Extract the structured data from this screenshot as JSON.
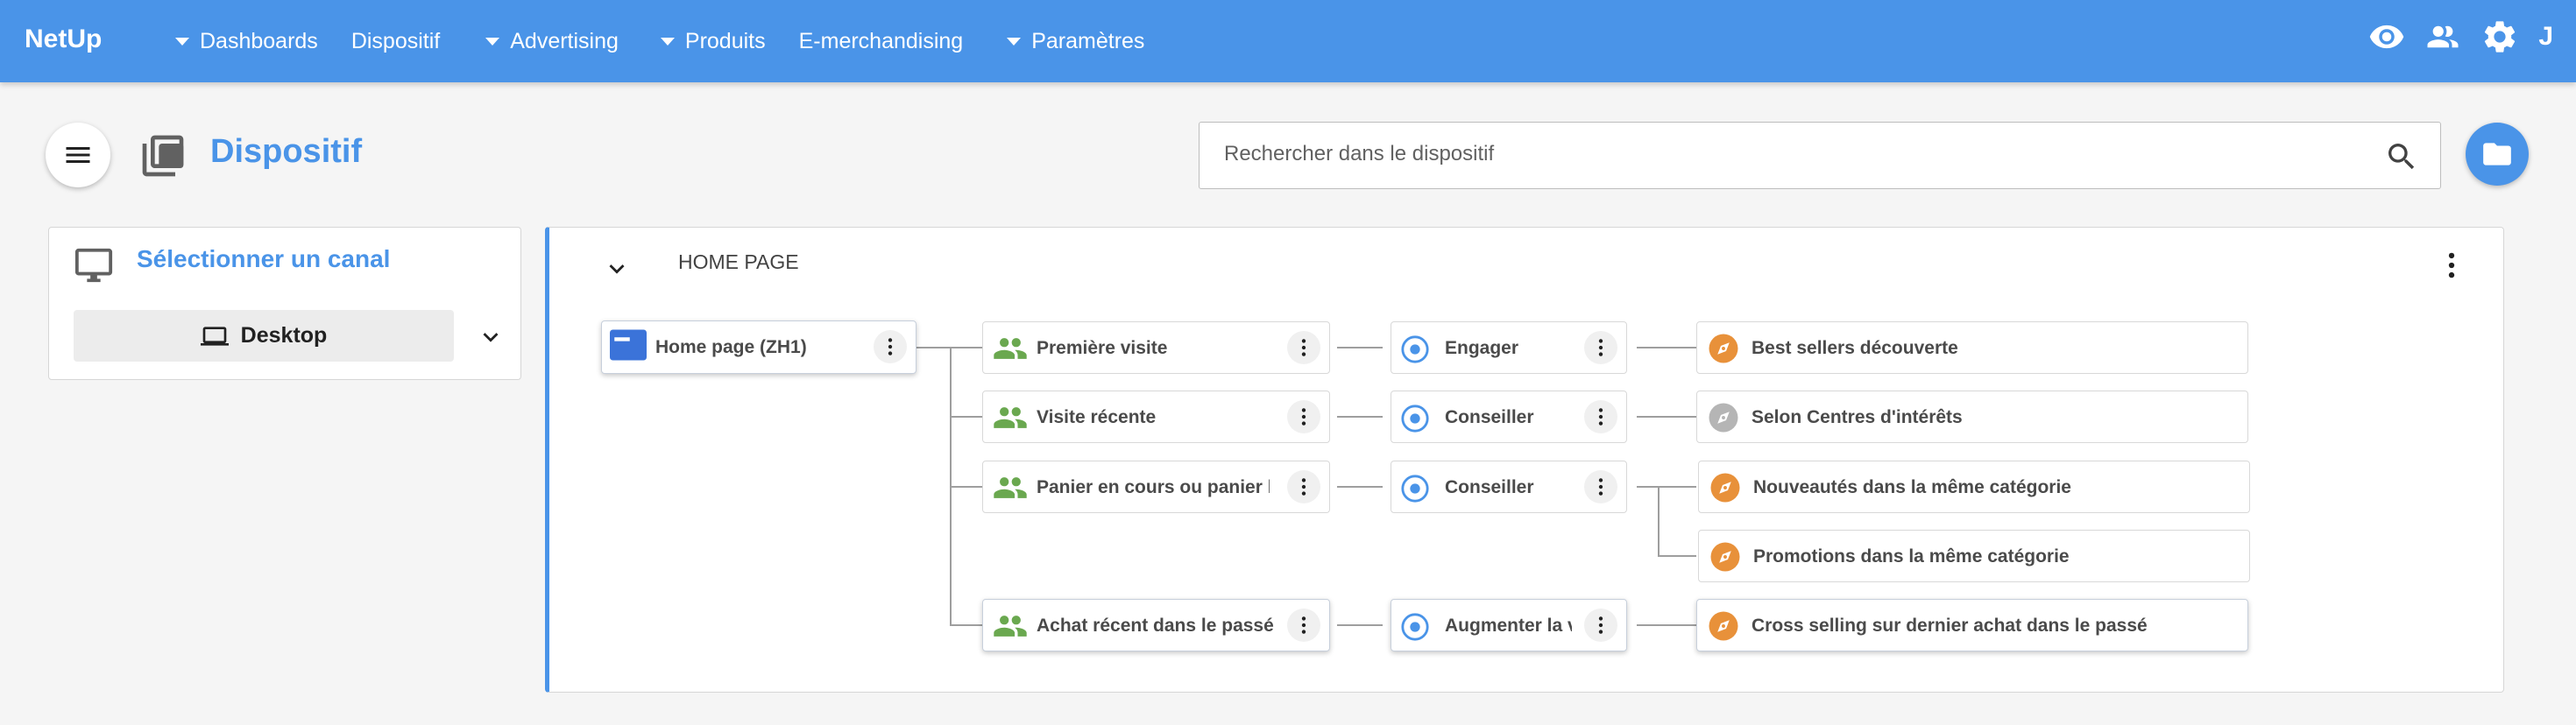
{
  "app": {
    "brand": "NetUp"
  },
  "nav": [
    {
      "label": "Dashboards",
      "dropdown": true
    },
    {
      "label": "Dispositif",
      "dropdown": false
    },
    {
      "label": "Advertising",
      "dropdown": true
    },
    {
      "label": "Produits",
      "dropdown": true
    },
    {
      "label": "E-merchandising",
      "dropdown": false
    },
    {
      "label": "Paramètres",
      "dropdown": true
    }
  ],
  "topbar_icons": [
    "eye-icon",
    "users-icon",
    "gear-icon"
  ],
  "user": {
    "initial": "J"
  },
  "page": {
    "title": "Dispositif"
  },
  "search": {
    "placeholder": "Rechercher dans le dispositif",
    "value": ""
  },
  "channel": {
    "title": "Sélectionner un canal",
    "selected": "Desktop"
  },
  "tree": {
    "title": "HOME PAGE",
    "root": {
      "label": "Home page (ZH1)",
      "icon": "page-icon"
    },
    "segments": [
      {
        "label": "Première visite",
        "icon": "people-icon"
      },
      {
        "label": "Visite récente",
        "icon": "people-icon"
      },
      {
        "label": "Panier en cours ou panier lo",
        "icon": "people-icon"
      },
      {
        "label": "Achat récent dans le passé",
        "icon": "people-icon"
      }
    ],
    "objectives": [
      {
        "label": "Engager",
        "icon": "target-icon"
      },
      {
        "label": "Conseiller",
        "icon": "target-icon"
      },
      {
        "label": "Conseiller",
        "icon": "target-icon"
      },
      {
        "label": "Augmenter la v",
        "icon": "target-icon"
      }
    ],
    "scenarios": [
      {
        "label": "Best sellers découverte",
        "icon": "compass-icon",
        "active": true
      },
      {
        "label": "Selon Centres d'intérêts",
        "icon": "compass-icon",
        "active": false
      },
      {
        "label": "Nouveautés dans la même catégorie",
        "icon": "compass-icon",
        "active": true
      },
      {
        "label": "Promotions dans la même catégorie",
        "icon": "compass-icon",
        "active": true
      },
      {
        "label": "Cross selling sur dernier achat dans le passé",
        "icon": "compass-icon",
        "active": true
      }
    ]
  },
  "colors": {
    "primary": "#4a94e8",
    "segment_green": "#6aa84f",
    "scenario_orange": "#e8913a",
    "scenario_inactive": "#b5b5b5",
    "page_blue": "#3b73d9"
  }
}
